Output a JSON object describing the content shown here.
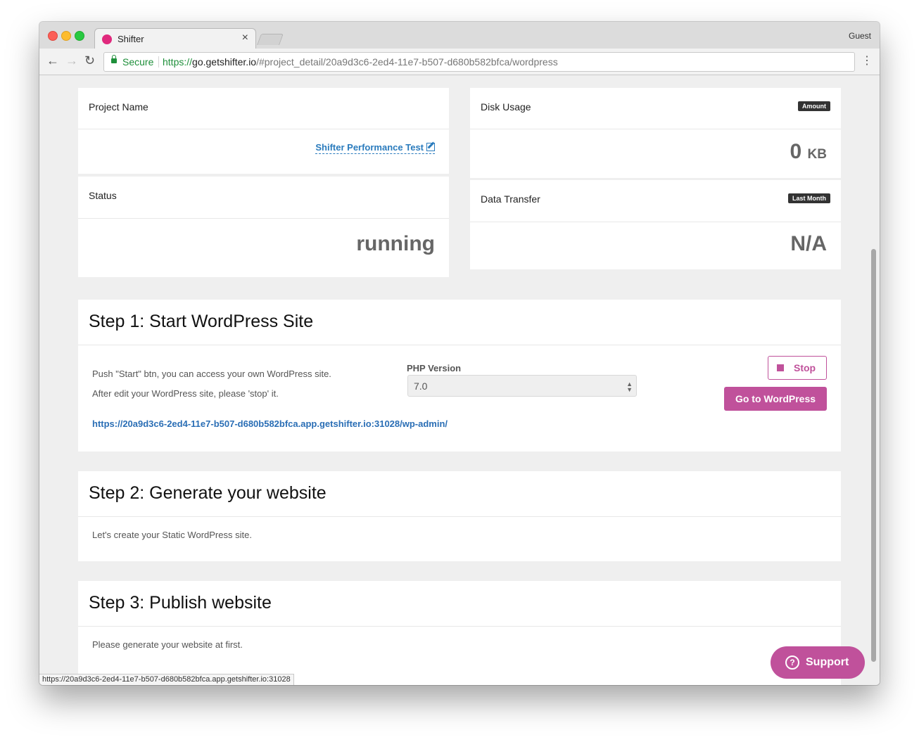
{
  "browser": {
    "tab_title": "Shifter",
    "tab_close": "×",
    "profile": "Guest",
    "back": "←",
    "forward": "→",
    "reload": "↻",
    "menu": "⋮",
    "secure_label": "Secure",
    "url_scheme": "https://",
    "url_host": "go.getshifter.io",
    "url_path": "/#project_detail/20a9d3c6-2ed4-11e7-b507-d680b582bfca/wordpress",
    "status_url": "https://20a9d3c6-2ed4-11e7-b507-d680b582bfca.app.getshifter.io:31028"
  },
  "project": {
    "name_label": "Project Name",
    "name_value": "Shifter Performance Test",
    "status_label": "Status",
    "status_value": "running"
  },
  "disk": {
    "label": "Disk Usage",
    "badge": "Amount",
    "value": "0",
    "unit": "KB"
  },
  "transfer": {
    "label": "Data Transfer",
    "badge": "Last Month",
    "value": "N/A"
  },
  "step1": {
    "title": "Step 1: Start WordPress Site",
    "text1": "Push \"Start\" btn, you can access your own WordPress site.",
    "text2": "After edit your WordPress site, please 'stop' it.",
    "php_label": "PHP Version",
    "php_value": "7.0",
    "stop_label": "Stop",
    "go_label": "Go to WordPress",
    "admin_link": "https://20a9d3c6-2ed4-11e7-b507-d680b582bfca.app.getshifter.io:31028/wp-admin/"
  },
  "step2": {
    "title": "Step 2: Generate your website",
    "text": "Let's create your Static WordPress site."
  },
  "step3": {
    "title": "Step 3: Publish website",
    "text": "Please generate your website at first."
  },
  "support": {
    "label": "Support",
    "icon": "?"
  },
  "colors": {
    "accent": "#c0519b",
    "link": "#2a6eb5",
    "secure": "#1e8f3a",
    "page_bg": "#efefef"
  }
}
